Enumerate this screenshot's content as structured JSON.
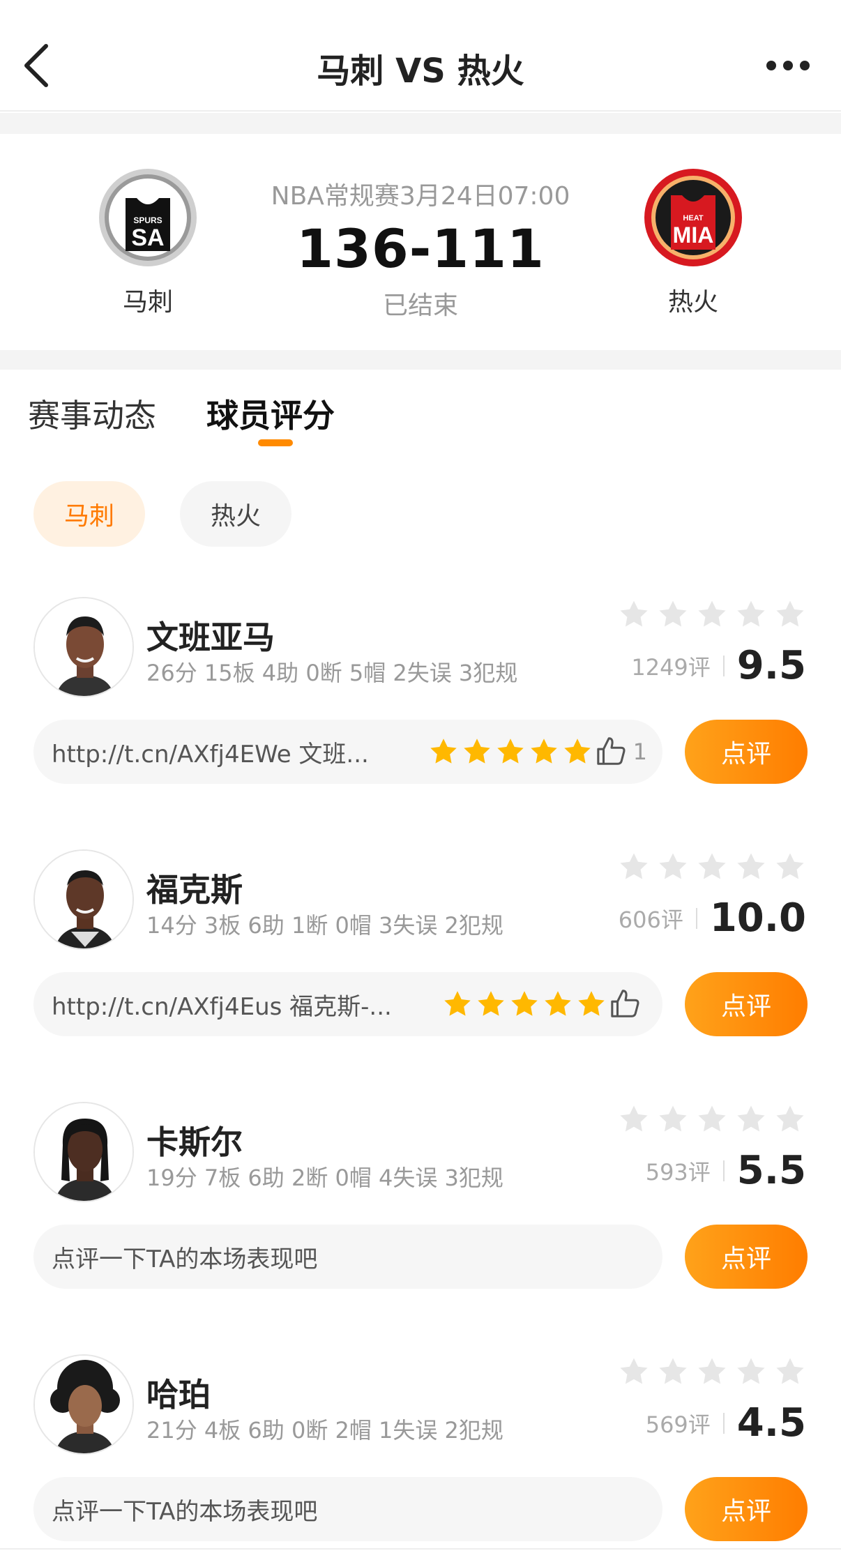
{
  "header": {
    "title": "马刺 VS 热火",
    "back_icon": "chevron-left-icon",
    "more_icon": "more-dots-icon"
  },
  "match": {
    "home": {
      "name": "马刺",
      "logo_top": "SPURS",
      "logo_main": "SA"
    },
    "away": {
      "name": "热火",
      "logo_top": "HEAT",
      "logo_main": "MIA"
    },
    "info": "NBA常规赛3月24日07:00",
    "score": "136-111",
    "status": "已结束"
  },
  "tabs": [
    {
      "label": "赛事动态"
    },
    {
      "label": "球员评分"
    }
  ],
  "team_filter": [
    {
      "label": "马刺"
    },
    {
      "label": "热火"
    }
  ],
  "players": [
    {
      "name": "文班亚马",
      "stats": "26分 15板 4助 0断 5帽 2失误 3犯规",
      "rating_count": "1249评",
      "score": "9.5",
      "comment": "http://t.cn/AXfj4EWe 文班...",
      "comment_stars": 5,
      "likes": "1",
      "button": "点评"
    },
    {
      "name": "福克斯",
      "stats": "14分 3板 6助 1断 0帽 3失误 2犯规",
      "rating_count": "606评",
      "score": "10.0",
      "comment": "http://t.cn/AXfj4Eus 福克斯-...",
      "comment_stars": 5,
      "likes": "",
      "button": "点评"
    },
    {
      "name": "卡斯尔",
      "stats": "19分 7板 6助 2断 0帽 4失误 3犯规",
      "rating_count": "593评",
      "score": "5.5",
      "comment": "点评一下TA的本场表现吧",
      "comment_stars": 0,
      "likes": "",
      "button": "点评"
    },
    {
      "name": "哈珀",
      "stats": "21分 4板 6助 0断 2帽 1失误 2犯规",
      "rating_count": "569评",
      "score": "4.5",
      "comment": "点评一下TA的本场表现吧",
      "comment_stars": 0,
      "likes": "",
      "button": "点评"
    }
  ],
  "colors": {
    "accent": "#ff8a00",
    "star_gold": "#ffb800",
    "star_gray": "#e6e6e6",
    "spurs": "#1a1a1a",
    "heat": "#d71920"
  }
}
